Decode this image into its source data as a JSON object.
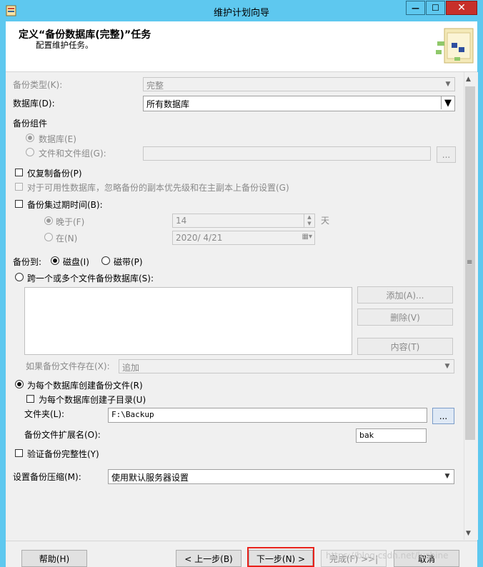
{
  "window": {
    "title": "维护计划向导",
    "controls": {
      "minimize": "—",
      "maximize": "☐",
      "close": "✕"
    }
  },
  "header": {
    "title": "定义“备份数据库(完整)”任务",
    "subtitle": "配置维护任务。"
  },
  "form": {
    "backup_type": {
      "label": "备份类型(K):",
      "value": "完整"
    },
    "database": {
      "label": "数据库(D):",
      "value": "所有数据库"
    },
    "backup_component": {
      "label": "备份组件",
      "database_option": "数据库(E)",
      "files_option": "文件和文件组(G):",
      "browse": "..."
    },
    "copy_only": {
      "label": "仅复制备份(P)"
    },
    "availability_note": {
      "label": "对于可用性数据库，忽略备份的副本优先级和在主副本上备份设置(G)"
    },
    "expire": {
      "label": "备份集过期时间(B):",
      "after_label": "晚于(F)",
      "after_value": "14",
      "after_unit": "天",
      "on_label": "在(N)",
      "on_value": "2020/ 4/21"
    },
    "backup_to": {
      "label": "备份到:",
      "disk": "磁盘(I)",
      "tape": "磁带(P)"
    },
    "across_files": {
      "label": "跨一个或多个文件备份数据库(S):"
    },
    "file_buttons": {
      "add": "添加(A)...",
      "remove": "删除(V)",
      "contents": "内容(T)"
    },
    "if_exists": {
      "label": "如果备份文件存在(X):",
      "value": "追加"
    },
    "per_db_file": {
      "label": "为每个数据库创建备份文件(R)"
    },
    "per_db_subdir": {
      "label": "为每个数据库创建子目录(U)"
    },
    "folder": {
      "label": "文件夹(L):",
      "value": "F:\\Backup",
      "browse": "..."
    },
    "extension": {
      "label": "备份文件扩展名(O):",
      "value": "bak"
    },
    "verify": {
      "label": "验证备份完整性(Y)"
    },
    "compression": {
      "label": "设置备份压缩(M):",
      "value": "使用默认服务器设置"
    }
  },
  "footer": {
    "help": "帮助(H)",
    "back": "< 上一步(B)",
    "next": "下一步(N) >",
    "finish": "完成(F) >>|",
    "cancel": "取消",
    "watermark": "https://blog.csdn.net/lushine"
  },
  "colors": {
    "titlebar": "#5ec8ef",
    "close_button": "#c7302a",
    "highlight": "#e8221b",
    "dialog_bg": "#f0f0f0"
  }
}
